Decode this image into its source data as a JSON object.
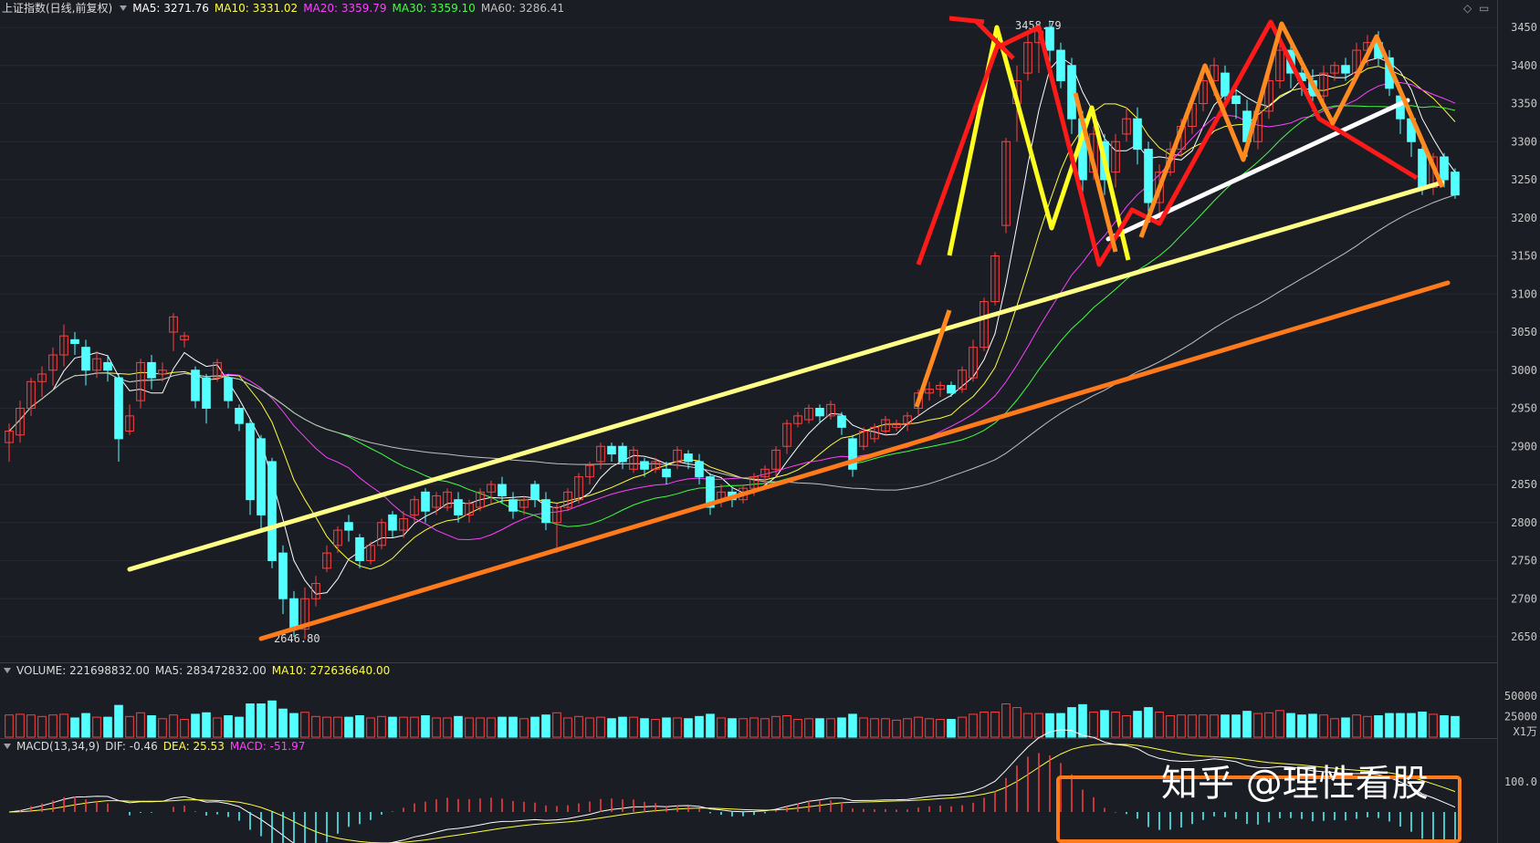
{
  "header": {
    "title": "上证指数(日线,前复权)",
    "ma5": "MA5: 3271.76",
    "ma10": "MA10: 3331.02",
    "ma20": "MA20: 3359.79",
    "ma30": "MA30: 3359.10",
    "ma60": "MA60: 3286.41"
  },
  "volume_header": {
    "volume": "VOLUME: 221698832.00",
    "ma5": "MA5: 283472832.00",
    "ma10": "MA10: 272636640.00"
  },
  "macd_header": {
    "name": "MACD(13,34,9)",
    "dif": "DIF: -0.46",
    "dea": "DEA: 25.53",
    "macd": "MACD: -51.97"
  },
  "watermark": "知乎 @理性看股",
  "colors": {
    "up": "#ff4040",
    "down": "#54ffff",
    "ma5": "#ffffff",
    "ma10": "#ffff40",
    "ma20": "#ff40ff",
    "ma30": "#40ff40",
    "ma60": "#c0c0c0",
    "trend_yellow": "#ffff88",
    "trend_orange": "#ff7a1a",
    "red_wave": "#ff1a1a",
    "orange_wave": "#ff8a20",
    "yellow_wave": "#ffff20",
    "white_line": "#ffffff"
  },
  "chart_data": {
    "type": "candlestick",
    "price_axis": {
      "ticks": [
        "3450",
        "3400",
        "3350",
        "3300",
        "3250",
        "3200",
        "3150",
        "3100",
        "3050",
        "3000",
        "2950",
        "2900",
        "2850",
        "2800",
        "2750",
        "2700",
        "2650"
      ],
      "range": [
        2620,
        3470
      ]
    },
    "volume_axis": {
      "ticks": [
        "50000",
        "25000"
      ],
      "unit": "X1万"
    },
    "macd_axis": {
      "ticks": [
        "100.0"
      ]
    },
    "annotations": {
      "high": "3458.79",
      "low": "2646.80"
    },
    "candles": [
      [
        2905,
        2920,
        2880,
        2930
      ],
      [
        2915,
        2950,
        2905,
        2960
      ],
      [
        2950,
        2985,
        2940,
        2990
      ],
      [
        2985,
        2995,
        2965,
        3005
      ],
      [
        3000,
        3020,
        2980,
        3030
      ],
      [
        3020,
        3045,
        3005,
        3060
      ],
      [
        3040,
        3035,
        3020,
        3050
      ],
      [
        3030,
        3000,
        2980,
        3040
      ],
      [
        3000,
        3015,
        2990,
        3025
      ],
      [
        3010,
        3000,
        2985,
        3020
      ],
      [
        2990,
        2910,
        2880,
        2995
      ],
      [
        2920,
        2940,
        2915,
        2955
      ],
      [
        2960,
        3010,
        2950,
        3015
      ],
      [
        3010,
        2990,
        2975,
        3020
      ],
      [
        2995,
        3000,
        2985,
        3010
      ],
      [
        3050,
        3070,
        3025,
        3075
      ],
      [
        3040,
        3045,
        3030,
        3050
      ],
      [
        3000,
        2960,
        2950,
        3005
      ],
      [
        2990,
        2950,
        2930,
        2995
      ],
      [
        2990,
        3010,
        2985,
        3015
      ],
      [
        2990,
        2960,
        2950,
        2995
      ],
      [
        2950,
        2930,
        2920,
        2955
      ],
      [
        2930,
        2830,
        2810,
        2935
      ],
      [
        2910,
        2810,
        2790,
        2915
      ],
      [
        2880,
        2750,
        2740,
        2885
      ],
      [
        2760,
        2700,
        2680,
        2770
      ],
      [
        2700,
        2660,
        2650,
        2710
      ],
      [
        2660,
        2700,
        2646.8,
        2715
      ],
      [
        2700,
        2720,
        2690,
        2730
      ],
      [
        2740,
        2760,
        2735,
        2770
      ],
      [
        2770,
        2790,
        2760,
        2795
      ],
      [
        2800,
        2790,
        2775,
        2810
      ],
      [
        2780,
        2750,
        2740,
        2785
      ],
      [
        2750,
        2770,
        2745,
        2775
      ],
      [
        2770,
        2800,
        2765,
        2805
      ],
      [
        2810,
        2790,
        2780,
        2815
      ],
      [
        2790,
        2805,
        2780,
        2815
      ],
      [
        2810,
        2830,
        2800,
        2835
      ],
      [
        2840,
        2815,
        2800,
        2845
      ],
      [
        2820,
        2835,
        2810,
        2840
      ],
      [
        2820,
        2840,
        2815,
        2845
      ],
      [
        2830,
        2810,
        2800,
        2840
      ],
      [
        2810,
        2825,
        2800,
        2830
      ],
      [
        2820,
        2840,
        2815,
        2845
      ],
      [
        2840,
        2850,
        2825,
        2855
      ],
      [
        2850,
        2835,
        2825,
        2860
      ],
      [
        2830,
        2815,
        2805,
        2840
      ],
      [
        2820,
        2830,
        2810,
        2835
      ],
      [
        2850,
        2830,
        2820,
        2855
      ],
      [
        2830,
        2800,
        2790,
        2840
      ],
      [
        2800,
        2820,
        2760,
        2825
      ],
      [
        2820,
        2840,
        2815,
        2845
      ],
      [
        2830,
        2860,
        2825,
        2865
      ],
      [
        2860,
        2875,
        2850,
        2880
      ],
      [
        2880,
        2900,
        2870,
        2905
      ],
      [
        2900,
        2890,
        2880,
        2905
      ],
      [
        2900,
        2880,
        2870,
        2905
      ],
      [
        2870,
        2895,
        2865,
        2900
      ],
      [
        2880,
        2870,
        2860,
        2885
      ],
      [
        2870,
        2880,
        2865,
        2885
      ],
      [
        2870,
        2860,
        2850,
        2880
      ],
      [
        2880,
        2895,
        2870,
        2900
      ],
      [
        2890,
        2880,
        2870,
        2895
      ],
      [
        2880,
        2860,
        2850,
        2890
      ],
      [
        2860,
        2820,
        2810,
        2865
      ],
      [
        2830,
        2840,
        2820,
        2850
      ],
      [
        2840,
        2830,
        2820,
        2845
      ],
      [
        2830,
        2845,
        2825,
        2850
      ],
      [
        2845,
        2860,
        2835,
        2865
      ],
      [
        2860,
        2870,
        2850,
        2875
      ],
      [
        2870,
        2895,
        2860,
        2900
      ],
      [
        2900,
        2930,
        2890,
        2935
      ],
      [
        2930,
        2940,
        2925,
        2945
      ],
      [
        2935,
        2950,
        2930,
        2955
      ],
      [
        2950,
        2940,
        2930,
        2955
      ],
      [
        2940,
        2955,
        2935,
        2960
      ],
      [
        2940,
        2925,
        2915,
        2945
      ],
      [
        2910,
        2870,
        2860,
        2915
      ],
      [
        2900,
        2920,
        2895,
        2925
      ],
      [
        2910,
        2925,
        2905,
        2930
      ],
      [
        2920,
        2935,
        2915,
        2940
      ],
      [
        2925,
        2930,
        2920,
        2935
      ],
      [
        2930,
        2940,
        2920,
        2945
      ],
      [
        2950,
        2970,
        2940,
        2975
      ],
      [
        2970,
        2975,
        2960,
        2985
      ],
      [
        2975,
        2980,
        2965,
        2985
      ],
      [
        2980,
        2970,
        2965,
        2985
      ],
      [
        2975,
        3000,
        2970,
        3005
      ],
      [
        2990,
        3030,
        2985,
        3040
      ],
      [
        3030,
        3090,
        3025,
        3095
      ],
      [
        3090,
        3150,
        3085,
        3155
      ],
      [
        3190,
        3300,
        3180,
        3305
      ],
      [
        3350,
        3380,
        3300,
        3400
      ],
      [
        3390,
        3430,
        3380,
        3440
      ],
      [
        3430,
        3445,
        3390,
        3450
      ],
      [
        3450,
        3420,
        3400,
        3458.79
      ],
      [
        3420,
        3380,
        3370,
        3430
      ],
      [
        3400,
        3330,
        3310,
        3410
      ],
      [
        3330,
        3250,
        3220,
        3340
      ],
      [
        3260,
        3310,
        3250,
        3320
      ],
      [
        3300,
        3250,
        3230,
        3310
      ],
      [
        3260,
        3300,
        3240,
        3310
      ],
      [
        3310,
        3330,
        3300,
        3345
      ],
      [
        3330,
        3290,
        3270,
        3345
      ],
      [
        3290,
        3220,
        3200,
        3300
      ],
      [
        3220,
        3260,
        3200,
        3270
      ],
      [
        3260,
        3290,
        3255,
        3300
      ],
      [
        3290,
        3320,
        3280,
        3330
      ],
      [
        3320,
        3350,
        3310,
        3360
      ],
      [
        3350,
        3380,
        3340,
        3390
      ],
      [
        3380,
        3400,
        3360,
        3410
      ],
      [
        3390,
        3360,
        3350,
        3400
      ],
      [
        3360,
        3350,
        3330,
        3380
      ],
      [
        3340,
        3300,
        3280,
        3355
      ],
      [
        3300,
        3340,
        3290,
        3350
      ],
      [
        3340,
        3380,
        3330,
        3395
      ],
      [
        3380,
        3420,
        3370,
        3450
      ],
      [
        3420,
        3390,
        3370,
        3430
      ],
      [
        3390,
        3380,
        3360,
        3410
      ],
      [
        3380,
        3360,
        3340,
        3395
      ],
      [
        3360,
        3390,
        3350,
        3400
      ],
      [
        3390,
        3400,
        3380,
        3405
      ],
      [
        3400,
        3390,
        3380,
        3410
      ],
      [
        3390,
        3420,
        3380,
        3430
      ],
      [
        3420,
        3430,
        3400,
        3440
      ],
      [
        3430,
        3410,
        3400,
        3445
      ],
      [
        3410,
        3370,
        3360,
        3420
      ],
      [
        3360,
        3330,
        3310,
        3370
      ],
      [
        3330,
        3300,
        3280,
        3340
      ],
      [
        3290,
        3240,
        3230,
        3300
      ],
      [
        3240,
        3280,
        3230,
        3285
      ],
      [
        3280,
        3250,
        3240,
        3285
      ],
      [
        3260,
        3230,
        3225,
        3265
      ]
    ]
  }
}
